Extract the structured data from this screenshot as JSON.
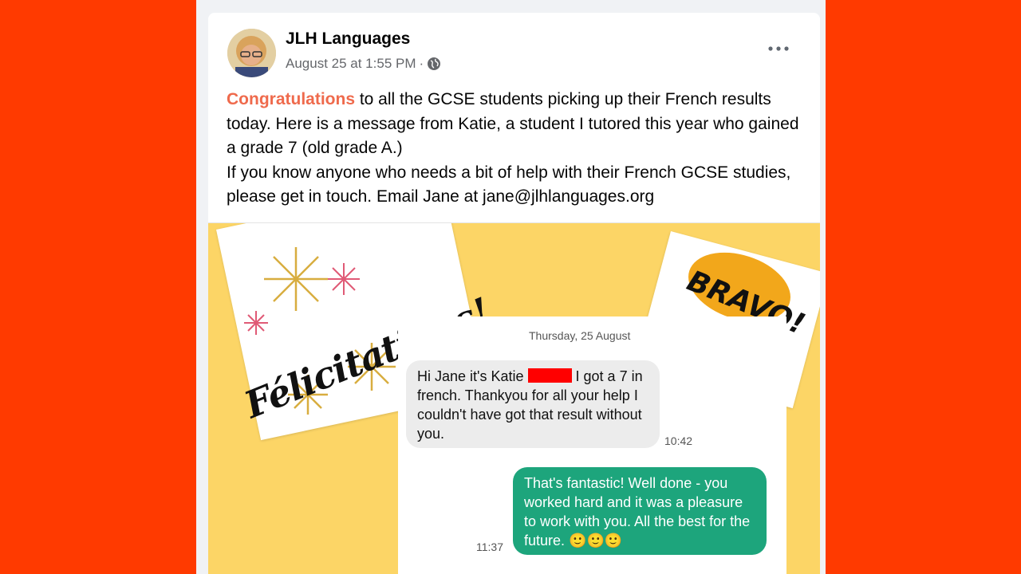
{
  "post": {
    "author": "JLH Languages",
    "date": "August 25 at 1:55 PM",
    "separator": "·",
    "audience_icon": "globe-icon",
    "menu_icon": "more-icon",
    "body": {
      "highlight": "Congratulations",
      "line1_rest": " to all the GCSE students picking up their French results today. Here is a message from Katie, a student I tutored this year who gained a grade 7 (old grade A.)",
      "line2": "If you know anyone who needs a bit of help with their French GCSE studies, please get in touch. Email Jane at jane@jlhlanguages.org"
    }
  },
  "image": {
    "felicitations": "Félicitations!",
    "bravo": "BRAVO!",
    "chat": {
      "date": "Thursday, 25 August",
      "incoming": {
        "part1": "Hi Jane it's Katie",
        "part2": "I got a 7 in french. Thankyou for all your help I couldn't have got that result without you.",
        "time": "10:42"
      },
      "outgoing": {
        "text": "That's fantastic! Well done - you worked hard and it was a pleasure to work with you. All the best for the future.",
        "emojis": "🙂🙂🙂",
        "time": "11:37"
      }
    }
  },
  "colors": {
    "background": "#ff3a00",
    "highlight": "#ef6a4c",
    "image_bg": "#fcd566",
    "outgoing_bubble": "#1da57c"
  }
}
